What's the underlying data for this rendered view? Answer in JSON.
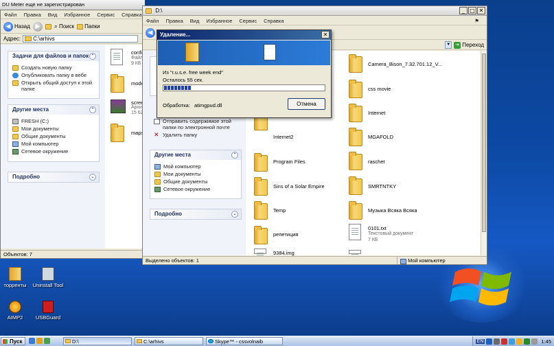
{
  "desktop": {
    "icons": [
      {
        "label": "торренты"
      },
      {
        "label": "Uninstall Tool"
      },
      {
        "label": "AIMP2"
      },
      {
        "label": "USBGuard"
      }
    ],
    "top_left_window_title": "DU Meter еще не зарегистрирован"
  },
  "menu": [
    "Файл",
    "Правка",
    "Вид",
    "Избранное",
    "Сервис",
    "Справка"
  ],
  "toolbar": {
    "back": "Назад",
    "search": "Поиск",
    "folders": "Папки"
  },
  "win1": {
    "address_label": "Адрес:",
    "address": "C:\\arhivs",
    "tasks_panel": {
      "title": "Задачи для файлов и папок",
      "items": [
        "Создать новую папку",
        "Опубликовать папку в вебе",
        "Открыть общий доступ к этой папке"
      ]
    },
    "places_panel": {
      "title": "Другие места",
      "items": [
        "FRESH (C:)",
        "Мои документы",
        "Общие документы",
        "Мой компьютер",
        "Сетевое окружение"
      ]
    },
    "details_panel": {
      "title": "Подробно"
    },
    "files": [
      {
        "name": "config",
        "sub": "Файл",
        "sub2": "9 КБ"
      },
      {
        "name": "mode"
      },
      {
        "name": "scree",
        "sub": "Архи",
        "sub2": "15 62"
      },
      {
        "name": "maps"
      }
    ],
    "status": "Объектов: 7"
  },
  "win2": {
    "title": "D:\\",
    "address_go": "Переход",
    "sidebar_items": [
      "Отправить содержимое этой папки по электронной почте",
      "Удалить папку"
    ],
    "places_panel": {
      "title": "Другие места",
      "items": [
        "Мой компьютер",
        "Мои документы",
        "Общие документы",
        "Сетевое окружение"
      ]
    },
    "details_panel": {
      "title": "Подробно"
    },
    "folders_left": [
      "Internet2",
      "Program Files",
      "Sins of a Solar Empire",
      "Temp",
      "репетиция",
      "9384.img"
    ],
    "folders_right": [
      "Camera_Bison_7.32.701.12_V...",
      "css movie",
      "Internet",
      "MGAFOLD",
      "raschet",
      "SMRTNTKY",
      "Музыка Всяка Всяка"
    ],
    "txt_file": {
      "name": "0101.txt",
      "type": "Текстовый документ",
      "size": "7 КБ"
    },
    "status_left": "Выделено объектов: 1",
    "status_right": "Мой компьютер"
  },
  "dialog": {
    "title": "Удаление...",
    "from": "Из \"r.u.s.e. free week end\"",
    "remaining": "Осталось 55 сек.",
    "processing_label": "Обработка:",
    "processing_file": "atimgpud.dll",
    "cancel": "Отмена",
    "progress": 0.17
  },
  "taskbar": {
    "start": "Пуск",
    "tasks": [
      "D:\\",
      "C:\\arhivs",
      "Skype™ - cssvolnaib"
    ],
    "lang": "EN",
    "clock": "1:45"
  }
}
